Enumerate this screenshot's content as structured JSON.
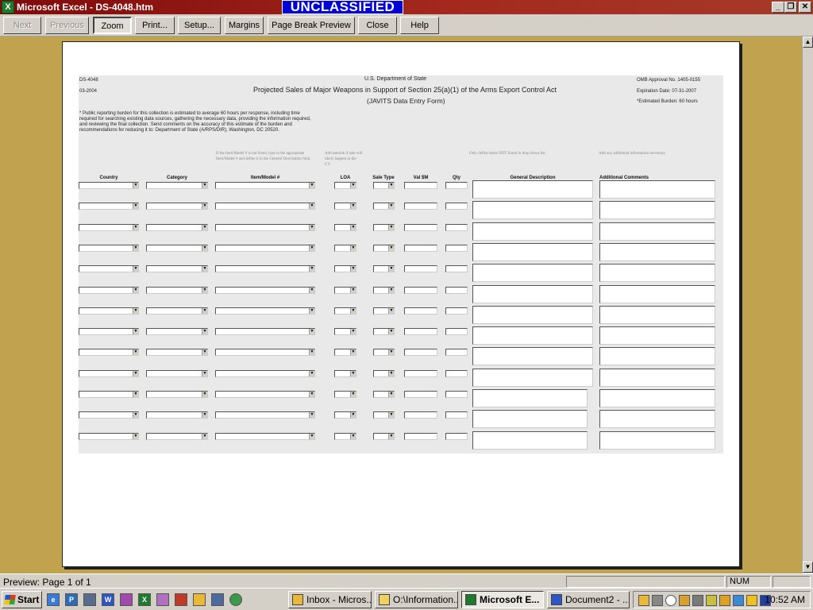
{
  "window": {
    "title": "Microsoft Excel - DS-4048.htm",
    "classification": "UNCLASSIFIED",
    "app_icon_glyph": "X",
    "min_glyph": "_",
    "restore_glyph": "❐",
    "close_glyph": "✕"
  },
  "toolbar": {
    "next": "Next",
    "previous": "Previous",
    "zoom": "Zoom",
    "print": "Print...",
    "setup": "Setup...",
    "margins": "Margins",
    "page_break_preview": "Page Break Preview",
    "close": "Close",
    "help": "Help"
  },
  "form": {
    "form_no": "DS-4048",
    "form_date": "03-2004",
    "agency": "U.S. Department of State",
    "title": "Projected Sales of Major Weapons in Support of Section 25(a)(1) of the Arms Export Control Act",
    "subtitle": "(JAVITS Data Entry Form)",
    "omb": "OMB Approval No. 1405-0155",
    "expiration": "Expiration Date:  07-31-2007",
    "burden_hours": "*Estimated Burden: 60 hours",
    "burden_statement": "* Public reporting burden for this collection is estimated to average 60 hours per response, including time required for searching existing data sources, gathering the necessary data, providing the information required, and reviewing the final collection. Send comments on the accuracy of this estimate of the burden and recommendations for reducing it to:  Department of State (A/RPS/DIR), Washington, DC 20520.",
    "hint_item": "If the Item/Model # is not listed, type in the appropriate Item/Model # and define it in the General Description field.",
    "hint_loa": "Add asterisk if sale will likely happen in the CY.",
    "hint_general": "Only define items NOT found in drop down list.",
    "hint_additional": "Add any additional information necessary.",
    "columns": {
      "country": "Country",
      "category": "Category",
      "item_model": "Item/Model #",
      "loa": "LOA",
      "sale_type": "Sale Type",
      "value": "Val $M",
      "qty": "Qty",
      "general_description": "General Description",
      "additional_comments": "Additional Comments"
    },
    "row_count": 13,
    "dropdown_glyph": "▼"
  },
  "status": {
    "text": "Preview: Page 1 of 1",
    "num": "NUM"
  },
  "taskbar": {
    "start": "Start",
    "tasks": [
      {
        "label": "Inbox - Micros...",
        "icon_color": "#e8b838"
      },
      {
        "label": "O:\\Information...",
        "icon_color": "#f0d060"
      },
      {
        "label": "Microsoft E...",
        "icon_color": "#1d7a2e"
      },
      {
        "label": "Document2 - ...",
        "icon_color": "#2c55c8"
      }
    ],
    "clock": "10:52 AM"
  },
  "scroll": {
    "up_glyph": "▲",
    "down_glyph": "▼"
  }
}
